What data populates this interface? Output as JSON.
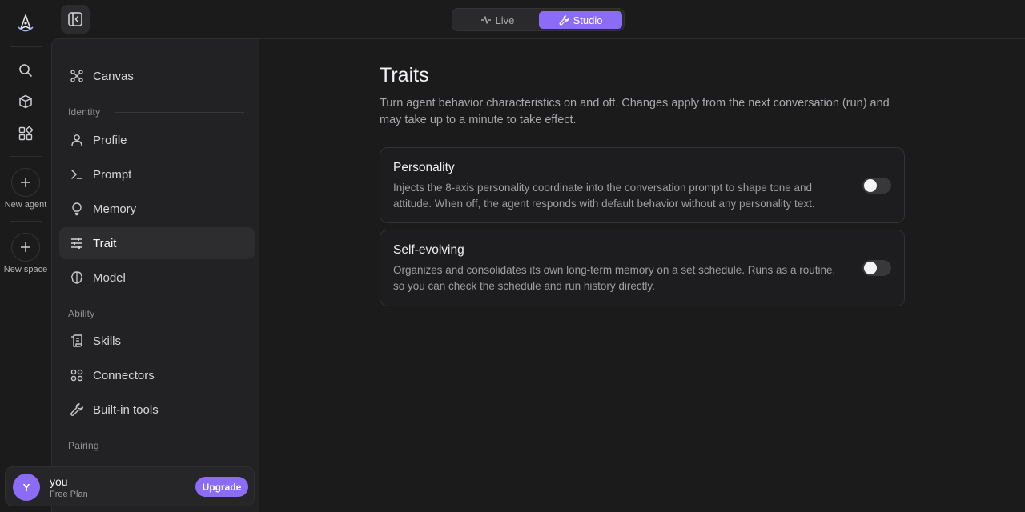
{
  "rail": {
    "new_agent_label": "New agent",
    "new_space_label": "New space"
  },
  "mode_switch": {
    "live_label": "Live",
    "studio_label": "Studio",
    "active": "Studio"
  },
  "sidebar": {
    "canvas_label": "Canvas",
    "sections": {
      "identity": "Identity",
      "ability": "Ability",
      "pairing": "Pairing"
    },
    "items": [
      {
        "label": "Profile"
      },
      {
        "label": "Prompt"
      },
      {
        "label": "Memory"
      },
      {
        "label": "Trait"
      },
      {
        "label": "Model"
      },
      {
        "label": "Skills"
      },
      {
        "label": "Connectors"
      },
      {
        "label": "Built-in tools"
      }
    ],
    "active_item": "Trait"
  },
  "user": {
    "initial": "Y",
    "name": "you",
    "plan": "Free Plan",
    "upgrade_label": "Upgrade"
  },
  "main": {
    "title": "Traits",
    "description": "Turn agent behavior characteristics on and off. Changes apply from the next conversation (run) and may take up to a minute to take effect.",
    "traits": [
      {
        "title": "Personality",
        "description": "Injects the 8-axis personality coordinate into the conversation prompt to shape tone and attitude. When off, the agent responds with default behavior without any personality text.",
        "enabled": false
      },
      {
        "title": "Self-evolving",
        "description": "Organizes and consolidates its own long-term memory on a set schedule. Runs as a routine, so you can check the schedule and run history directly.",
        "enabled": false
      }
    ]
  },
  "colors": {
    "accent": "#8b6cf6",
    "background": "#1b1b1c",
    "sidebar": "#222224"
  }
}
